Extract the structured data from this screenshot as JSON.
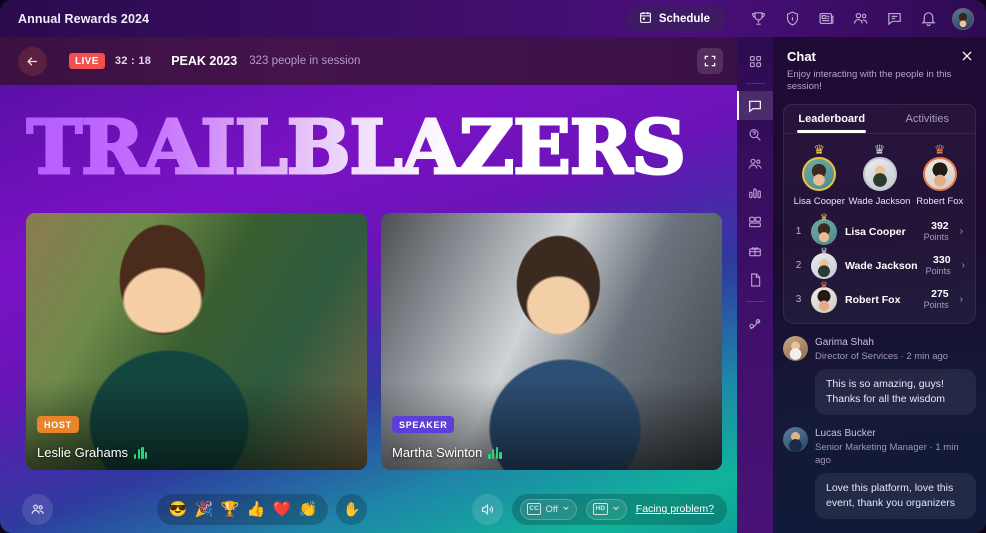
{
  "topbar": {
    "app_title": "Annual Rewards 2024",
    "schedule_label": "Schedule",
    "icons": [
      "trophy-icon",
      "shield-info-icon",
      "news-icon",
      "people-icon",
      "chat-bubble-icon",
      "bell-icon"
    ]
  },
  "session": {
    "back": "back-arrow",
    "live_label": "LIVE",
    "timer": "32 : 18",
    "name": "PEAK 2023",
    "people_count": "323 people in session",
    "expand": "fullscreen-icon"
  },
  "stage": {
    "title": "TRAILBLAZERS",
    "tiles": [
      {
        "role": "HOST",
        "role_color": "#e8852a",
        "name": "Leslie Grahams",
        "speaking": true
      },
      {
        "role": "SPEAKER",
        "role_color": "#5c3fd6",
        "name": "Martha Swinton",
        "speaking": true
      }
    ]
  },
  "controls": {
    "participants_icon": "people-icon",
    "reactions": [
      "😎",
      "🎉",
      "🏆",
      "👍",
      "❤️",
      "👏"
    ],
    "raise_hand": "✋",
    "volume_icon": "speaker-icon",
    "cc_label": "CC",
    "cc_value": "Off",
    "quality_label": "HD",
    "facing_problem": "Facing problem?"
  },
  "rail": {
    "items": [
      {
        "name": "apps-grid-icon",
        "active": false
      },
      {
        "name": "chat-icon",
        "active": true
      },
      {
        "name": "qa-icon",
        "active": false
      },
      {
        "name": "people-icon",
        "active": false
      },
      {
        "name": "polls-icon",
        "active": false
      },
      {
        "name": "booth-icon",
        "active": false
      },
      {
        "name": "gift-icon",
        "active": false
      },
      {
        "name": "files-icon",
        "active": false
      },
      {
        "name": "dna-icon",
        "active": false
      }
    ]
  },
  "chat": {
    "title": "Chat",
    "subtitle": "Enjoy interacting with the people in this session!",
    "close_icon": "close-icon",
    "tabs": [
      {
        "label": "Leaderboard",
        "active": true
      },
      {
        "label": "Activities",
        "active": false
      }
    ],
    "podium": [
      {
        "name": "Lisa Cooper",
        "medal": "gold",
        "crown": "♛"
      },
      {
        "name": "Wade Jackson",
        "medal": "silver",
        "crown": "♛"
      },
      {
        "name": "Robert Fox",
        "medal": "bronze",
        "crown": "♛"
      }
    ],
    "leaderboard": [
      {
        "rank": "1",
        "name": "Lisa Cooper",
        "points": "392",
        "points_label": "Points",
        "medal": "gold",
        "chevron": "›"
      },
      {
        "rank": "2",
        "name": "Wade Jackson",
        "points": "330",
        "points_label": "Points",
        "medal": "silver",
        "chevron": "›"
      },
      {
        "rank": "3",
        "name": "Robert Fox",
        "points": "275",
        "points_label": "Points",
        "medal": "bronze",
        "chevron": "›"
      }
    ],
    "messages": [
      {
        "author": "Garima Shah",
        "meta": "Director of Services · 2 min ago",
        "text": "This is so amazing, guys! Thanks for all the wisdom"
      },
      {
        "author": "Lucas Bucker",
        "meta": "Senior Marketing Manager · 1 min ago",
        "text": "Love this platform, love this event, thank you organizers"
      }
    ]
  },
  "colors": {
    "live_red": "#f1504f",
    "host_orange": "#e8852a",
    "speaker_purple": "#5c3fd6",
    "gold": "#eec23a",
    "silver": "#c3c8d1",
    "bronze": "#e8794a"
  }
}
